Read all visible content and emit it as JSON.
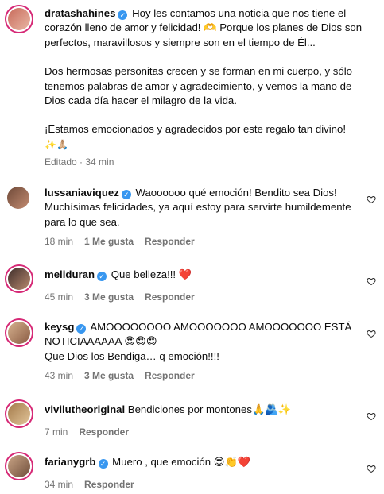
{
  "comments": [
    {
      "username": "dratashahines",
      "text_lines": [
        "Hoy les contamos una noticia que nos tiene el corazón lleno de amor y felicidad! 🫶 Porque los planes de Dios son perfectos, maravillosos y siempre son en el tiempo de Él...",
        "",
        "Dos hermosas personitas crecen y se forman en mi cuerpo, y sólo tenemos palabras de amor y agradecimiento, y vemos la mano de Dios cada día hacer el milagro de la vida.",
        "",
        "¡Estamos emocionados y agradecidos por este regalo tan divino!",
        "✨🙏🏼"
      ],
      "meta": {
        "edited": "Editado",
        "time": "34 min"
      }
    },
    {
      "username": "lussaniaviquez",
      "text": "Waoooooo qué emoción! Bendito sea Dios! Muchísimas felicidades, ya aquí estoy para servirte humildemente para lo que sea.",
      "meta": {
        "time": "18 min",
        "likes": "1 Me gusta",
        "reply": "Responder"
      }
    },
    {
      "username": "meliduran",
      "text": "Que belleza!!! ❤️",
      "meta": {
        "time": "45 min",
        "likes": "3 Me gusta",
        "reply": "Responder"
      }
    },
    {
      "username": "keysg",
      "text": "AMOOOOOOOO AMOOOOOOO AMOOOOOOO ESTÁ NOTICIAAAAAA 😍😍😍",
      "text2": "Que Dios los Bendiga… q emoción!!!!",
      "meta": {
        "time": "43 min",
        "likes": "3 Me gusta",
        "reply": "Responder"
      }
    },
    {
      "username": "vivilutheoriginal",
      "text": "Bendiciones por montones🙏🫂✨",
      "meta": {
        "time": "7 min",
        "reply": "Responder"
      }
    },
    {
      "username": "farianygrb",
      "text": "Muero , que emoción 😍👏❤️",
      "meta": {
        "time": "34 min",
        "reply": "Responder"
      }
    }
  ],
  "colors": {
    "ring": "#d62976",
    "verified": "#3897f0",
    "meta": "#737373"
  }
}
